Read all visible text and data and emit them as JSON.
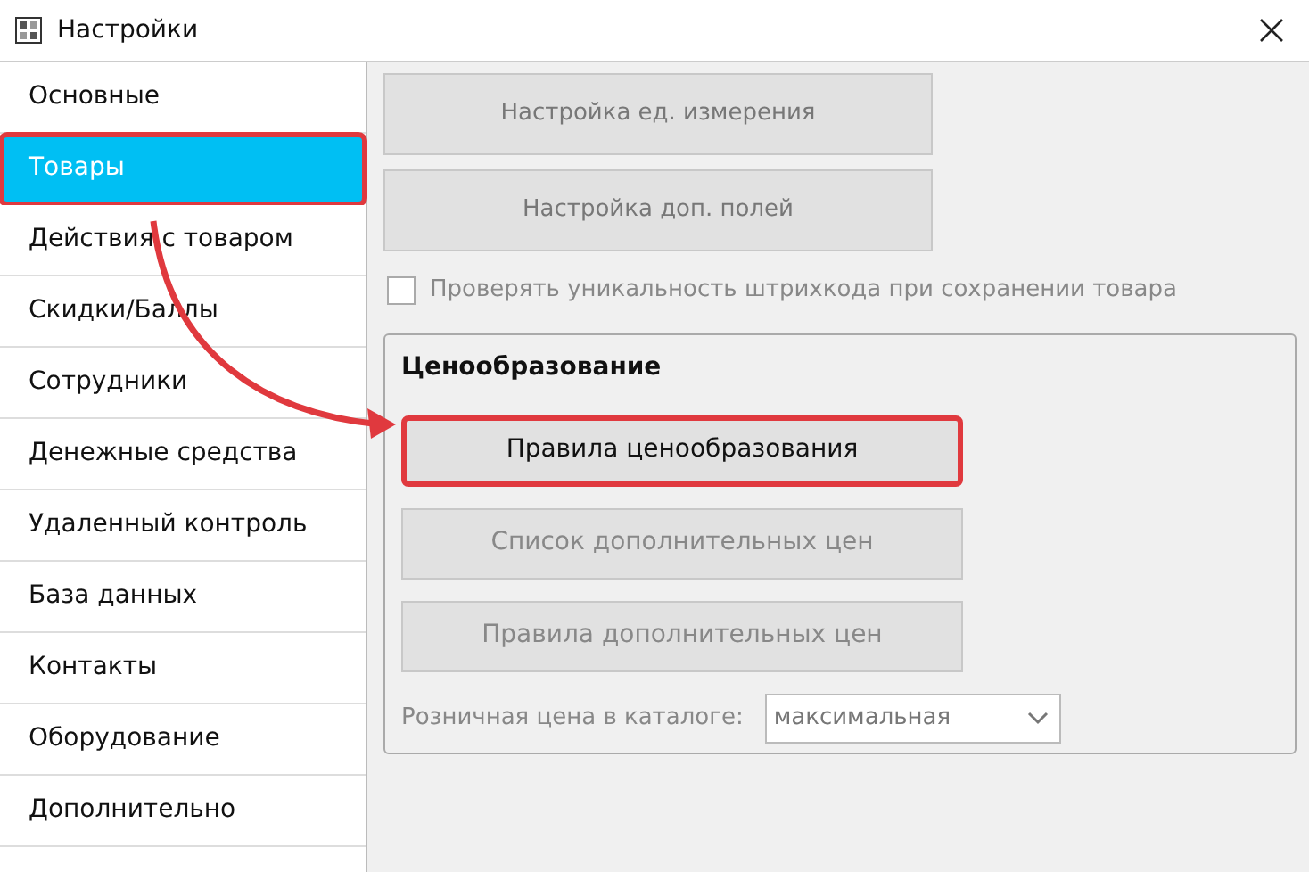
{
  "window": {
    "title": "Настройки"
  },
  "sidebar": {
    "items": [
      {
        "label": "Основные",
        "selected": false,
        "highlighted": false
      },
      {
        "label": "Товары",
        "selected": true,
        "highlighted": true
      },
      {
        "label": "Действия с товаром",
        "selected": false,
        "highlighted": false
      },
      {
        "label": "Скидки/Баллы",
        "selected": false,
        "highlighted": false
      },
      {
        "label": "Сотрудники",
        "selected": false,
        "highlighted": false
      },
      {
        "label": "Денежные средства",
        "selected": false,
        "highlighted": false
      },
      {
        "label": "Удаленный контроль",
        "selected": false,
        "highlighted": false
      },
      {
        "label": "База данных",
        "selected": false,
        "highlighted": false
      },
      {
        "label": "Контакты",
        "selected": false,
        "highlighted": false
      },
      {
        "label": "Оборудование",
        "selected": false,
        "highlighted": false
      },
      {
        "label": "Дополнительно",
        "selected": false,
        "highlighted": false
      }
    ]
  },
  "top_buttons": [
    {
      "label": "Настройка ед. измерения"
    },
    {
      "label": "Настройка доп. полей"
    }
  ],
  "barcode_check": {
    "label": "Проверять уникальность штрихкода при сохранении товара",
    "checked": false
  },
  "pricing": {
    "title": "Ценообразование",
    "buttons": [
      {
        "label": "Правила ценообразования",
        "highlighted": true
      },
      {
        "label": "Список дополнительных цен",
        "highlighted": false
      },
      {
        "label": "Правила дополнительных цен",
        "highlighted": false
      }
    ],
    "catalog_price": {
      "label": "Розничная цена в каталоге:",
      "value": "максимальная"
    }
  }
}
